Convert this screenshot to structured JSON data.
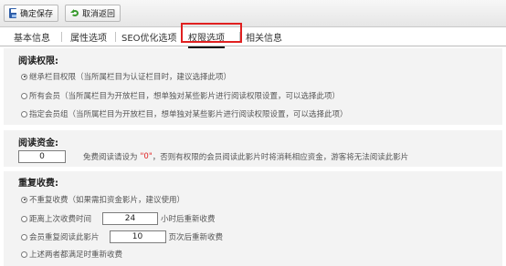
{
  "toolbar": {
    "save_label": "确定保存",
    "cancel_label": "取消返回"
  },
  "tabs": [
    {
      "label": "基本信息"
    },
    {
      "label": "属性选项"
    },
    {
      "label": "SEO优化选项"
    },
    {
      "label": "权限选项",
      "active": true
    },
    {
      "label": "相关信息"
    }
  ],
  "read_permission": {
    "title": "阅读权限:",
    "options": [
      {
        "label": "继承栏目权限（当所属栏目为认证栏目时，建议选择此项）",
        "checked": true
      },
      {
        "label": "所有会员（当所属栏目为开放栏目，想单独对某些影片进行阅读权限设置，可以选择此项）",
        "checked": false
      },
      {
        "label": "指定会员组（当所属栏目为开放栏目，想单独对某些影片进行阅读权限设置，可以选择此项）",
        "checked": false
      }
    ]
  },
  "read_fee": {
    "title": "阅读资金:",
    "value": "0",
    "note_before": "免费阅读请设为",
    "note_quote": "\"0\"",
    "note_after": "，否则有权限的会员阅读此影片时将消耗相应资金，游客将无法阅读此影片"
  },
  "repeat_fee": {
    "title": "重复收费:",
    "opt1": "不重复收费（如果需扣资金影片，建议使用）",
    "opt2_before": "距离上次收费时间",
    "opt2_value": "24",
    "opt2_after": "小时后重新收费",
    "opt3_before": "会员重复阅读此影片",
    "opt3_value": "10",
    "opt3_after": "页次后重新收费",
    "opt4": "上述两者都满足时重新收费",
    "selected": 1
  }
}
